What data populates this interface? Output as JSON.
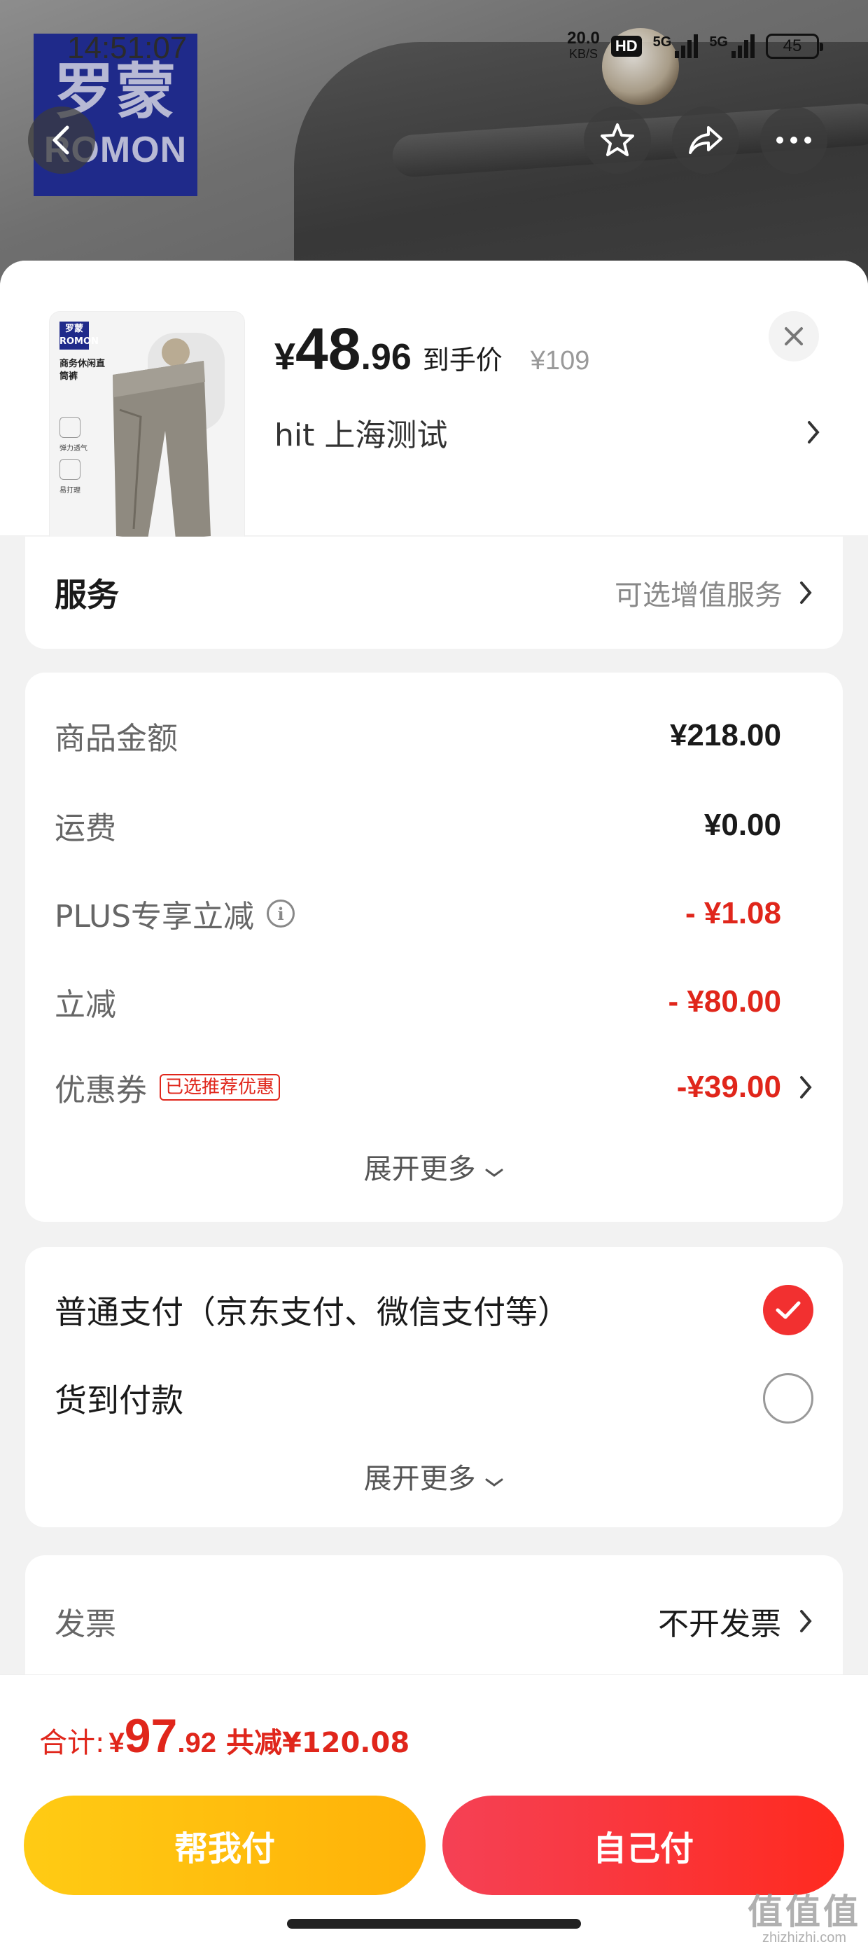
{
  "status_bar": {
    "time": "14:51:07",
    "net_speed": "20.0",
    "net_speed_unit": "KB/S",
    "hd_badge": "HD",
    "signal1_label": "5G",
    "signal2_label": "5G",
    "battery": "45"
  },
  "header": {
    "brand_logo_cn": "罗蒙",
    "brand_logo_en": "ROMON",
    "icons": [
      "back-arrow-icon",
      "star-icon",
      "share-icon",
      "more-dots-icon"
    ]
  },
  "product": {
    "thumb_logo": "罗蒙 ROMON",
    "thumb_title": "商务休闲直筒裤",
    "thumb_feature_1": "弹力透气",
    "thumb_feature_2": "易打理",
    "price_symbol": "¥",
    "price_int": "48",
    "price_dec": ".96",
    "price_label": "到手价",
    "original_price": "¥109",
    "address": "hit  上海测试"
  },
  "service": {
    "label": "服务",
    "hint": "可选增值服务"
  },
  "amounts": {
    "rows": [
      {
        "label": "商品金额",
        "value": "¥218.00"
      },
      {
        "label": "运费",
        "value": "¥0.00"
      },
      {
        "label": "PLUS专享立减",
        "value": "- ¥1.08"
      },
      {
        "label": "立减",
        "value": "- ¥80.00"
      },
      {
        "label": "优惠券",
        "badge": "已选推荐优惠",
        "value": "-¥39.00"
      }
    ],
    "expand_label": "展开更多"
  },
  "payment": {
    "options": [
      {
        "label": "普通支付（京东支付、微信支付等）",
        "selected": true
      },
      {
        "label": "货到付款",
        "selected": false
      }
    ],
    "expand_label": "展开更多"
  },
  "invoice": {
    "label": "发票",
    "value": "不开发票"
  },
  "footer": {
    "total_label": "合计:",
    "total_symbol": "¥",
    "total_int": "97",
    "total_dec": ".92",
    "saved": "共减¥120.08",
    "help_pay_label": "帮我付",
    "self_pay_label": "自己付",
    "watermark": "值值值",
    "watermark_sub": "zhizhizhi.com"
  },
  "colors": {
    "accent_red": "#e0261b",
    "help_pay_yellow": "#ffb108",
    "self_pay_red": "#ff2a1f"
  }
}
